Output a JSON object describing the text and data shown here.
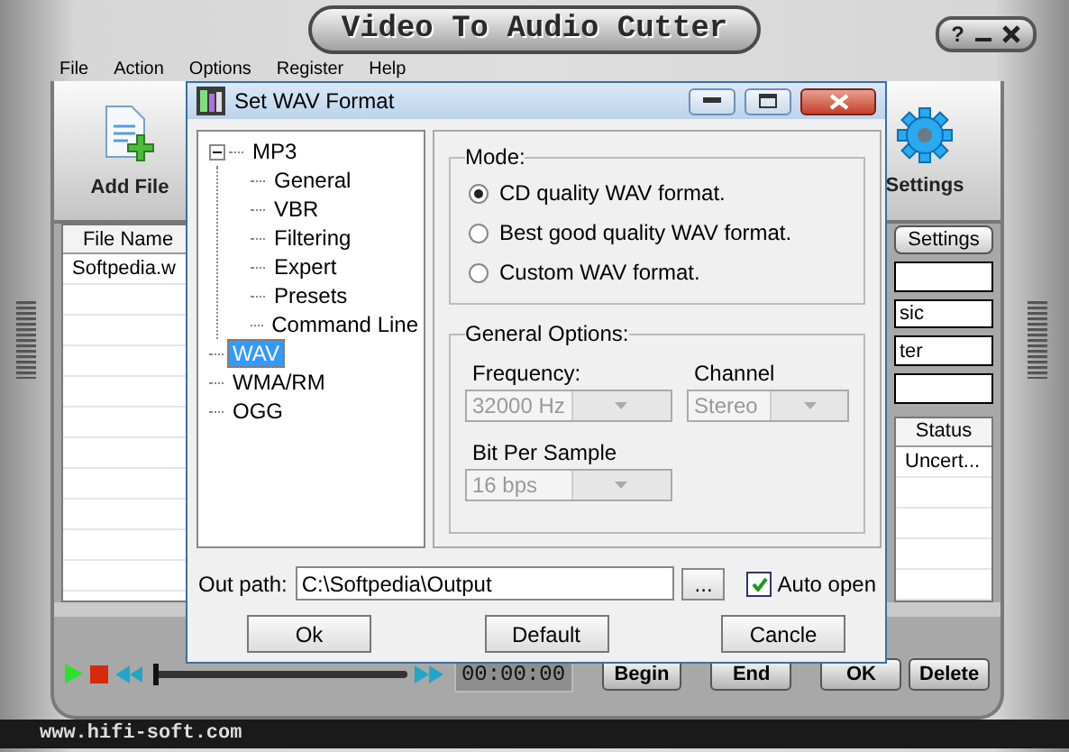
{
  "window": {
    "title": "Video To Audio Cutter",
    "controls": [
      {
        "kind": "help",
        "label": "?"
      },
      {
        "kind": "minimize"
      },
      {
        "kind": "close"
      }
    ]
  },
  "menu": [
    "File",
    "Action",
    "Options",
    "Register",
    "Help"
  ],
  "toolbar": [
    {
      "kind": "add-file",
      "label": "Add File"
    },
    {
      "kind": "settings",
      "label": "Settings"
    }
  ],
  "file_table": {
    "columns": [
      "File Name"
    ],
    "rows": [
      [
        "Softpedia.w"
      ]
    ]
  },
  "side_panel": {
    "button": "Settings",
    "fields": [
      "sic",
      "ter"
    ]
  },
  "status_table": {
    "columns": [
      "Status"
    ],
    "rows": [
      [
        "Uncert..."
      ]
    ]
  },
  "player": {
    "level": 0,
    "time": "00:00:00",
    "buttons": [
      "Begin",
      "End",
      "OK",
      "Delete"
    ]
  },
  "footer": "www.hifi-soft.com",
  "dialog": {
    "title": "Set WAV Format",
    "tree": [
      {
        "label": "MP3",
        "expanded": true,
        "selected": false,
        "children": [
          {
            "label": "General",
            "selected": false
          },
          {
            "label": "VBR",
            "selected": false
          },
          {
            "label": "Filtering",
            "selected": false
          },
          {
            "label": "Expert",
            "selected": false
          },
          {
            "label": "Presets",
            "selected": false
          },
          {
            "label": "Command Line",
            "selected": false
          }
        ]
      },
      {
        "label": "WAV",
        "selected": true
      },
      {
        "label": "WMA/RM",
        "selected": false
      },
      {
        "label": "OGG",
        "selected": false
      }
    ],
    "mode": {
      "label": "Mode:",
      "options": [
        {
          "label": "CD quality WAV format.",
          "selected": true
        },
        {
          "label": "Best good quality WAV format.",
          "selected": false
        },
        {
          "label": "Custom WAV format.",
          "selected": false
        }
      ]
    },
    "general_options": {
      "label": "General Options:",
      "frequency": {
        "label": "Frequency:",
        "value": "32000 Hz",
        "disabled": true
      },
      "channel": {
        "label": "Channel",
        "value": "Stereo",
        "disabled": true
      },
      "bit_per_sample": {
        "label": "Bit Per Sample",
        "value": "16 bps",
        "disabled": true
      }
    },
    "out_path": {
      "label": "Out path:",
      "value": "C:\\Softpedia\\Output",
      "browse": "..."
    },
    "auto_open": {
      "label": "Auto open",
      "checked": true
    },
    "buttons": [
      "Ok",
      "Default",
      "Cancle"
    ]
  }
}
